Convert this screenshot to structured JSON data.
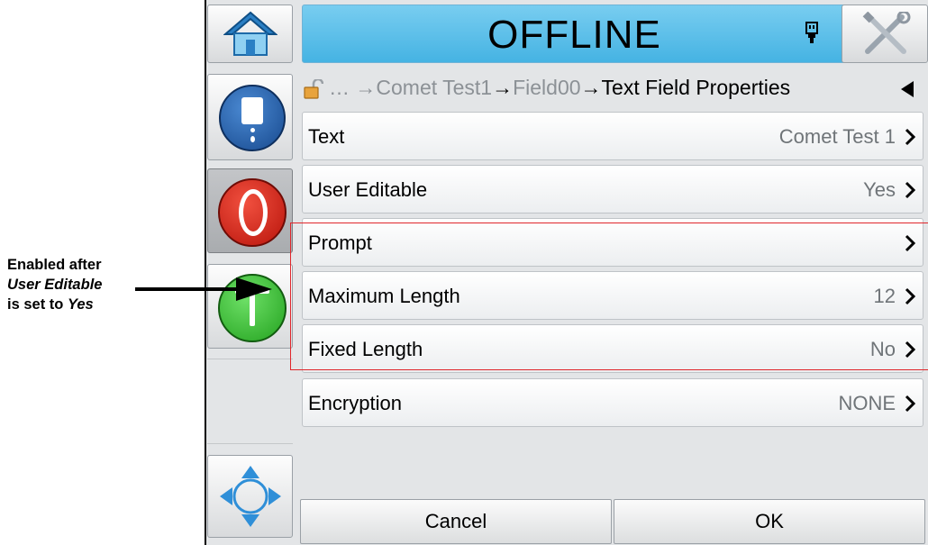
{
  "annotation": {
    "line1": "Enabled after",
    "line2": "User Editable",
    "line3_prefix": "is set to ",
    "line3_value": "Yes"
  },
  "header": {
    "status": "OFFLINE"
  },
  "breadcrumb": {
    "ellipsis": "…",
    "items": [
      "Comet Test1",
      "Field00",
      "Text Field Properties"
    ],
    "separator": "→"
  },
  "rows": [
    {
      "label": "Text",
      "value": "Comet Test 1"
    },
    {
      "label": "User Editable",
      "value": "Yes"
    },
    {
      "label": "Prompt",
      "value": ""
    },
    {
      "label": "Maximum Length",
      "value": "12"
    },
    {
      "label": "Fixed Length",
      "value": "No"
    },
    {
      "label": "Encryption",
      "value": "NONE"
    }
  ],
  "footer": {
    "cancel_label": "Cancel",
    "ok_label": "OK"
  },
  "sidebar": {
    "icons": [
      "home-icon",
      "ink-cartridge-icon",
      "stop-icon",
      "start-icon",
      "navigate-icon"
    ]
  },
  "colors": {
    "header_bg": "#45b3e3",
    "highlight_box": "#e0262b",
    "stop_red": "#e12a1c",
    "start_green": "#3fbf3a",
    "info_blue": "#1f5fa8"
  }
}
